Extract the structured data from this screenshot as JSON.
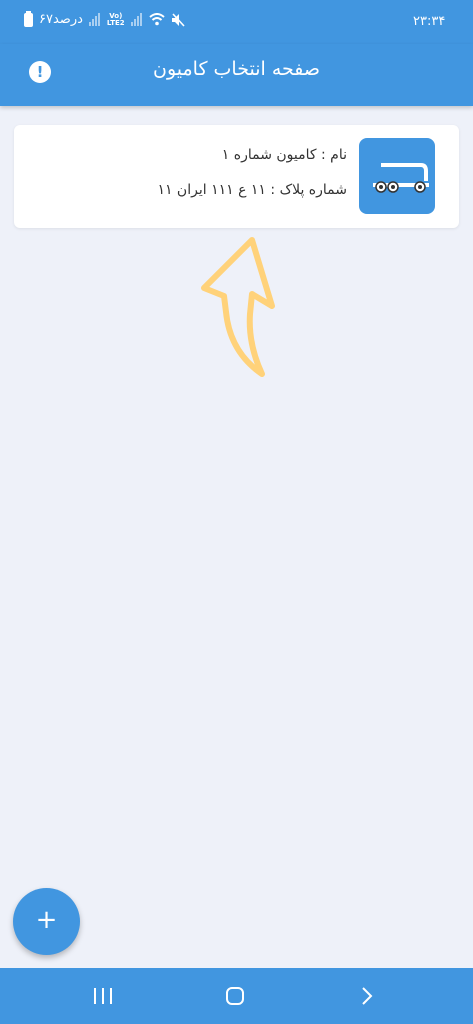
{
  "status_bar": {
    "time": "۲۳:۳۴",
    "battery": "۶۷درصد",
    "network": "Vo)) LTE2"
  },
  "app_bar": {
    "title": "صفحه انتخاب کامیون",
    "info_icon": "exclamation-circle-icon"
  },
  "trucks": [
    {
      "name": "نام : کامیون شماره ۱",
      "plate": "شماره پلاک : ۱۱ ع ۱۱۱ ایران ۱۱",
      "icon": "truck-icon"
    }
  ],
  "fab": {
    "label": "+"
  },
  "colors": {
    "primary": "#4196e0",
    "background": "#eef1f9",
    "hint_arrow": "#ffd27a"
  }
}
